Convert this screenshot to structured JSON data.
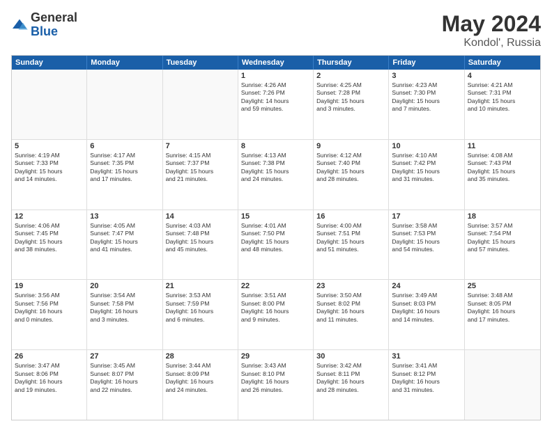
{
  "header": {
    "logo_general": "General",
    "logo_blue": "Blue",
    "title": "May 2024",
    "location": "Kondol', Russia"
  },
  "calendar": {
    "days_of_week": [
      "Sunday",
      "Monday",
      "Tuesday",
      "Wednesday",
      "Thursday",
      "Friday",
      "Saturday"
    ],
    "weeks": [
      {
        "cells": [
          {
            "day": "",
            "text": "",
            "empty": true
          },
          {
            "day": "",
            "text": "",
            "empty": true
          },
          {
            "day": "",
            "text": "",
            "empty": true
          },
          {
            "day": "1",
            "text": "Sunrise: 4:26 AM\nSunset: 7:26 PM\nDaylight: 14 hours\nand 59 minutes."
          },
          {
            "day": "2",
            "text": "Sunrise: 4:25 AM\nSunset: 7:28 PM\nDaylight: 15 hours\nand 3 minutes."
          },
          {
            "day": "3",
            "text": "Sunrise: 4:23 AM\nSunset: 7:30 PM\nDaylight: 15 hours\nand 7 minutes."
          },
          {
            "day": "4",
            "text": "Sunrise: 4:21 AM\nSunset: 7:31 PM\nDaylight: 15 hours\nand 10 minutes."
          }
        ]
      },
      {
        "cells": [
          {
            "day": "5",
            "text": "Sunrise: 4:19 AM\nSunset: 7:33 PM\nDaylight: 15 hours\nand 14 minutes."
          },
          {
            "day": "6",
            "text": "Sunrise: 4:17 AM\nSunset: 7:35 PM\nDaylight: 15 hours\nand 17 minutes."
          },
          {
            "day": "7",
            "text": "Sunrise: 4:15 AM\nSunset: 7:37 PM\nDaylight: 15 hours\nand 21 minutes."
          },
          {
            "day": "8",
            "text": "Sunrise: 4:13 AM\nSunset: 7:38 PM\nDaylight: 15 hours\nand 24 minutes."
          },
          {
            "day": "9",
            "text": "Sunrise: 4:12 AM\nSunset: 7:40 PM\nDaylight: 15 hours\nand 28 minutes."
          },
          {
            "day": "10",
            "text": "Sunrise: 4:10 AM\nSunset: 7:42 PM\nDaylight: 15 hours\nand 31 minutes."
          },
          {
            "day": "11",
            "text": "Sunrise: 4:08 AM\nSunset: 7:43 PM\nDaylight: 15 hours\nand 35 minutes."
          }
        ]
      },
      {
        "cells": [
          {
            "day": "12",
            "text": "Sunrise: 4:06 AM\nSunset: 7:45 PM\nDaylight: 15 hours\nand 38 minutes."
          },
          {
            "day": "13",
            "text": "Sunrise: 4:05 AM\nSunset: 7:47 PM\nDaylight: 15 hours\nand 41 minutes."
          },
          {
            "day": "14",
            "text": "Sunrise: 4:03 AM\nSunset: 7:48 PM\nDaylight: 15 hours\nand 45 minutes."
          },
          {
            "day": "15",
            "text": "Sunrise: 4:01 AM\nSunset: 7:50 PM\nDaylight: 15 hours\nand 48 minutes."
          },
          {
            "day": "16",
            "text": "Sunrise: 4:00 AM\nSunset: 7:51 PM\nDaylight: 15 hours\nand 51 minutes."
          },
          {
            "day": "17",
            "text": "Sunrise: 3:58 AM\nSunset: 7:53 PM\nDaylight: 15 hours\nand 54 minutes."
          },
          {
            "day": "18",
            "text": "Sunrise: 3:57 AM\nSunset: 7:54 PM\nDaylight: 15 hours\nand 57 minutes."
          }
        ]
      },
      {
        "cells": [
          {
            "day": "19",
            "text": "Sunrise: 3:56 AM\nSunset: 7:56 PM\nDaylight: 16 hours\nand 0 minutes."
          },
          {
            "day": "20",
            "text": "Sunrise: 3:54 AM\nSunset: 7:58 PM\nDaylight: 16 hours\nand 3 minutes."
          },
          {
            "day": "21",
            "text": "Sunrise: 3:53 AM\nSunset: 7:59 PM\nDaylight: 16 hours\nand 6 minutes."
          },
          {
            "day": "22",
            "text": "Sunrise: 3:51 AM\nSunset: 8:00 PM\nDaylight: 16 hours\nand 9 minutes."
          },
          {
            "day": "23",
            "text": "Sunrise: 3:50 AM\nSunset: 8:02 PM\nDaylight: 16 hours\nand 11 minutes."
          },
          {
            "day": "24",
            "text": "Sunrise: 3:49 AM\nSunset: 8:03 PM\nDaylight: 16 hours\nand 14 minutes."
          },
          {
            "day": "25",
            "text": "Sunrise: 3:48 AM\nSunset: 8:05 PM\nDaylight: 16 hours\nand 17 minutes."
          }
        ]
      },
      {
        "cells": [
          {
            "day": "26",
            "text": "Sunrise: 3:47 AM\nSunset: 8:06 PM\nDaylight: 16 hours\nand 19 minutes."
          },
          {
            "day": "27",
            "text": "Sunrise: 3:45 AM\nSunset: 8:07 PM\nDaylight: 16 hours\nand 22 minutes."
          },
          {
            "day": "28",
            "text": "Sunrise: 3:44 AM\nSunset: 8:09 PM\nDaylight: 16 hours\nand 24 minutes."
          },
          {
            "day": "29",
            "text": "Sunrise: 3:43 AM\nSunset: 8:10 PM\nDaylight: 16 hours\nand 26 minutes."
          },
          {
            "day": "30",
            "text": "Sunrise: 3:42 AM\nSunset: 8:11 PM\nDaylight: 16 hours\nand 28 minutes."
          },
          {
            "day": "31",
            "text": "Sunrise: 3:41 AM\nSunset: 8:12 PM\nDaylight: 16 hours\nand 31 minutes."
          },
          {
            "day": "",
            "text": "",
            "empty": true
          }
        ]
      }
    ]
  }
}
